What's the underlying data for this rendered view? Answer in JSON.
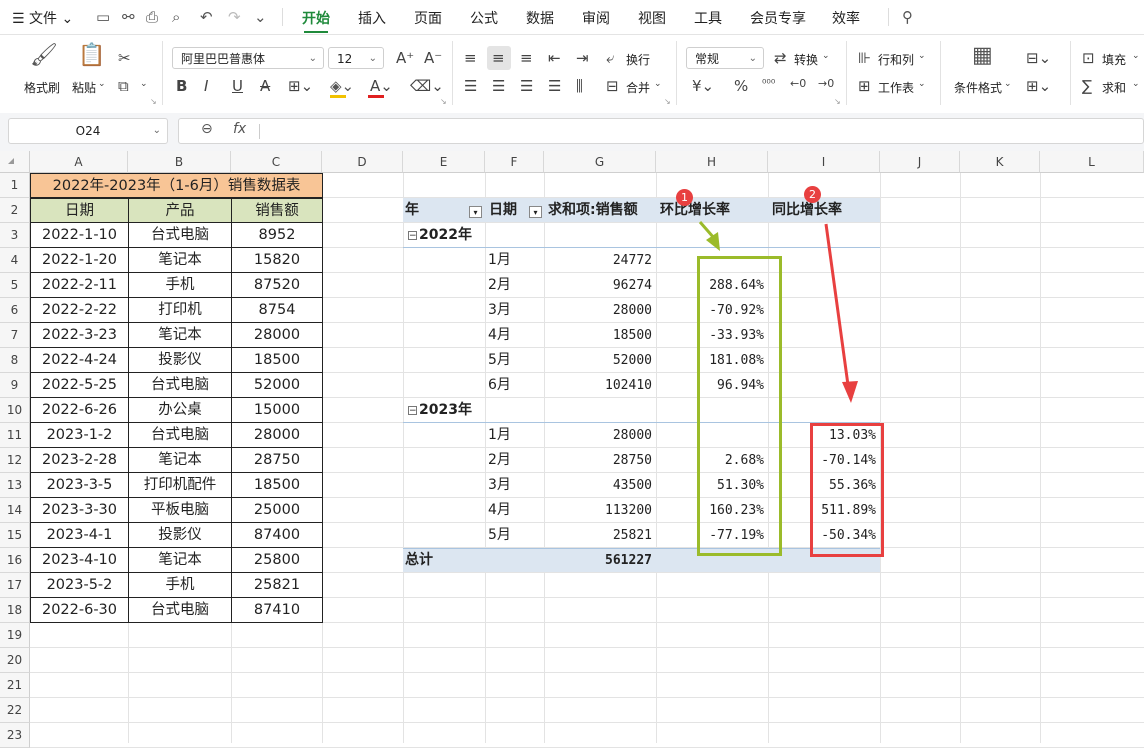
{
  "menu": {
    "file": "文件",
    "tabs": [
      "开始",
      "插入",
      "页面",
      "公式",
      "数据",
      "审阅",
      "视图",
      "工具",
      "会员专享",
      "效率"
    ],
    "active_tab": "开始"
  },
  "ribbon": {
    "format_painter": "格式刷",
    "paste": "粘贴",
    "font_name": "阿里巴巴普惠体",
    "font_size": "12",
    "wrap": "换行",
    "merge": "合并",
    "number_format": "常规",
    "convert": "转换",
    "rows_cols": "行和列",
    "worksheet": "工作表",
    "conditional_format": "条件格式",
    "fill": "填充",
    "sum": "求和"
  },
  "formula_bar": {
    "name_box": "O24",
    "fx": "fx",
    "formula": ""
  },
  "columns": [
    "A",
    "B",
    "C",
    "D",
    "E",
    "F",
    "G",
    "H",
    "I",
    "J",
    "K",
    "L"
  ],
  "rows": [
    "1",
    "2",
    "3",
    "4",
    "5",
    "6",
    "7",
    "8",
    "9",
    "10",
    "11",
    "12",
    "13",
    "14",
    "15",
    "16",
    "17",
    "18",
    "19",
    "20",
    "21",
    "22",
    "23"
  ],
  "source_table": {
    "title": "2022年-2023年（1-6月）销售数据表",
    "headers": [
      "日期",
      "产品",
      "销售额"
    ],
    "rows": [
      [
        "2022-1-10",
        "台式电脑",
        "8952"
      ],
      [
        "2022-1-20",
        "笔记本",
        "15820"
      ],
      [
        "2022-2-11",
        "手机",
        "87520"
      ],
      [
        "2022-2-22",
        "打印机",
        "8754"
      ],
      [
        "2022-3-23",
        "笔记本",
        "28000"
      ],
      [
        "2022-4-24",
        "投影仪",
        "18500"
      ],
      [
        "2022-5-25",
        "台式电脑",
        "52000"
      ],
      [
        "2022-6-26",
        "办公桌",
        "15000"
      ],
      [
        "2023-1-2",
        "台式电脑",
        "28000"
      ],
      [
        "2023-2-28",
        "笔记本",
        "28750"
      ],
      [
        "2023-3-5",
        "打印机配件",
        "18500"
      ],
      [
        "2023-3-30",
        "平板电脑",
        "25000"
      ],
      [
        "2023-4-1",
        "投影仪",
        "87400"
      ],
      [
        "2023-4-10",
        "笔记本",
        "25800"
      ],
      [
        "2023-5-2",
        "手机",
        "25821"
      ],
      [
        "2022-6-30",
        "台式电脑",
        "87410"
      ]
    ]
  },
  "pivot": {
    "headers": [
      "年",
      "日期",
      "求和项:销售额",
      "环比增长率",
      "同比增长率"
    ],
    "groups": [
      {
        "year": "2022年",
        "rows": [
          [
            "1月",
            "24772",
            "",
            ""
          ],
          [
            "2月",
            "96274",
            "288.64%",
            ""
          ],
          [
            "3月",
            "28000",
            "-70.92%",
            ""
          ],
          [
            "4月",
            "18500",
            "-33.93%",
            ""
          ],
          [
            "5月",
            "52000",
            "181.08%",
            ""
          ],
          [
            "6月",
            "102410",
            "96.94%",
            ""
          ]
        ]
      },
      {
        "year": "2023年",
        "rows": [
          [
            "1月",
            "28000",
            "",
            "13.03%"
          ],
          [
            "2月",
            "28750",
            "2.68%",
            "-70.14%"
          ],
          [
            "3月",
            "43500",
            "51.30%",
            "55.36%"
          ],
          [
            "4月",
            "113200",
            "160.23%",
            "511.89%"
          ],
          [
            "5月",
            "25821",
            "-77.19%",
            "-50.34%"
          ]
        ]
      }
    ],
    "total_label": "总计",
    "total_value": "561227"
  },
  "annotations": {
    "badge1": "1",
    "badge2": "2",
    "green": "#9bbb2a",
    "red": "#e84040"
  },
  "colors": {
    "accent": "#1f8a3b",
    "title_fill": "#f8c596",
    "header_fill": "#d9e4be",
    "pivot_header": "#dce6f1"
  }
}
